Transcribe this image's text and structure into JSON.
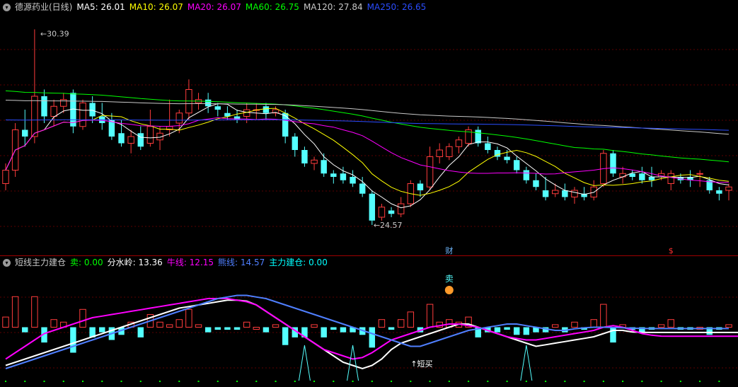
{
  "main_legend": {
    "title": "德源药业(日线)",
    "items": [
      {
        "label": "MA5: 26.01",
        "color": "#ffffff"
      },
      {
        "label": "MA10: 26.07",
        "color": "#ffff00"
      },
      {
        "label": "MA20: 26.07",
        "color": "#ff00ff"
      },
      {
        "label": "MA60: 26.75",
        "color": "#00ff00"
      },
      {
        "label": "MA120: 27.84",
        "color": "#c8c8c8"
      },
      {
        "label": "MA250: 26.65",
        "color": "#2a4dff"
      }
    ]
  },
  "sub_legend": {
    "title": "短线主力建仓",
    "items": [
      {
        "label": "卖: 0.00",
        "color": "#00ff00"
      },
      {
        "label": "分水岭: 13.36",
        "color": "#ffffff"
      },
      {
        "label": "牛线: 12.15",
        "color": "#ff00ff"
      },
      {
        "label": "熊线: 14.57",
        "color": "#4f7fff"
      },
      {
        "label": "主力建仓: 0.00",
        "color": "#00ffff"
      }
    ]
  },
  "chart_data": [
    {
      "type": "candlestick",
      "title": "德源药业(日线)",
      "annotations": {
        "high": "30.39",
        "low": "24.57",
        "fin_marker": "财",
        "dollar_marker": "$"
      },
      "ylim": [
        24.0,
        30.8
      ],
      "candles": [
        [
          25.8,
          26.4,
          25.6,
          26.2
        ],
        [
          26.2,
          27.6,
          26.0,
          27.4
        ],
        [
          27.4,
          28.0,
          26.9,
          27.2
        ],
        [
          27.2,
          30.39,
          27.0,
          28.4
        ],
        [
          28.4,
          28.6,
          27.6,
          27.8
        ],
        [
          27.8,
          28.3,
          27.5,
          28.1
        ],
        [
          28.1,
          28.5,
          27.9,
          28.3
        ],
        [
          28.5,
          28.6,
          27.3,
          27.5
        ],
        [
          27.5,
          28.3,
          27.4,
          28.2
        ],
        [
          28.2,
          28.4,
          27.6,
          27.8
        ],
        [
          27.8,
          28.2,
          27.4,
          27.6
        ],
        [
          27.7,
          27.9,
          27.1,
          27.2
        ],
        [
          27.3,
          27.7,
          26.9,
          27.0
        ],
        [
          27.0,
          27.4,
          26.7,
          27.2
        ],
        [
          27.3,
          27.5,
          26.8,
          26.9
        ],
        [
          27.0,
          28.0,
          26.9,
          27.5
        ],
        [
          27.1,
          27.5,
          26.8,
          27.3
        ],
        [
          27.4,
          28.3,
          27.2,
          27.5
        ],
        [
          27.6,
          28.0,
          27.3,
          27.9
        ],
        [
          27.9,
          28.9,
          27.7,
          28.6
        ],
        [
          28.2,
          28.5,
          28.0,
          28.3
        ],
        [
          28.3,
          28.5,
          27.9,
          28.1
        ],
        [
          28.1,
          28.2,
          27.8,
          28.0
        ],
        [
          27.9,
          28.1,
          27.7,
          27.8
        ],
        [
          27.8,
          28.0,
          27.6,
          27.7
        ],
        [
          27.8,
          28.2,
          27.6,
          28.0
        ],
        [
          28.0,
          28.2,
          27.7,
          28.0
        ],
        [
          28.1,
          28.2,
          27.7,
          27.9
        ],
        [
          27.9,
          28.1,
          27.8,
          28.0
        ],
        [
          27.9,
          28.0,
          27.0,
          27.2
        ],
        [
          27.2,
          27.3,
          26.6,
          26.8
        ],
        [
          26.8,
          26.9,
          26.3,
          26.4
        ],
        [
          26.4,
          26.6,
          26.2,
          26.5
        ],
        [
          26.5,
          26.7,
          26.0,
          26.1
        ],
        [
          26.1,
          26.2,
          25.8,
          26.0
        ],
        [
          26.1,
          26.3,
          25.8,
          25.9
        ],
        [
          26.0,
          26.2,
          25.7,
          25.8
        ],
        [
          25.8,
          26.0,
          25.4,
          25.5
        ],
        [
          25.5,
          25.6,
          24.57,
          24.7
        ],
        [
          24.8,
          25.2,
          24.7,
          25.1
        ],
        [
          25.0,
          25.1,
          24.8,
          24.9
        ],
        [
          24.9,
          25.4,
          24.8,
          25.2
        ],
        [
          25.2,
          25.9,
          25.1,
          25.8
        ],
        [
          25.8,
          25.9,
          25.4,
          25.6
        ],
        [
          25.7,
          26.9,
          25.6,
          26.6
        ],
        [
          26.6,
          27.0,
          26.4,
          26.8
        ],
        [
          26.6,
          27.0,
          26.5,
          26.9
        ],
        [
          26.9,
          27.2,
          26.7,
          27.1
        ],
        [
          27.0,
          27.5,
          26.9,
          27.4
        ],
        [
          27.4,
          27.5,
          26.9,
          27.0
        ],
        [
          27.0,
          27.2,
          26.7,
          26.8
        ],
        [
          26.8,
          26.9,
          26.5,
          26.6
        ],
        [
          26.6,
          26.8,
          26.4,
          26.5
        ],
        [
          26.5,
          26.6,
          26.1,
          26.2
        ],
        [
          26.2,
          26.3,
          25.8,
          25.9
        ],
        [
          25.9,
          26.1,
          25.6,
          25.7
        ],
        [
          25.6,
          26.0,
          25.3,
          25.4
        ],
        [
          25.5,
          25.8,
          25.4,
          25.6
        ],
        [
          25.6,
          25.8,
          25.3,
          25.4
        ],
        [
          25.4,
          25.7,
          25.2,
          25.6
        ],
        [
          25.5,
          25.7,
          25.3,
          25.4
        ],
        [
          25.4,
          25.9,
          25.3,
          25.7
        ],
        [
          25.8,
          26.8,
          25.7,
          26.7
        ],
        [
          26.7,
          26.8,
          26.0,
          26.1
        ],
        [
          26.0,
          26.3,
          25.8,
          26.1
        ],
        [
          26.1,
          26.2,
          25.9,
          26.0
        ],
        [
          26.1,
          26.3,
          25.8,
          25.9
        ],
        [
          26.0,
          26.3,
          25.7,
          25.9
        ],
        [
          26.0,
          26.2,
          25.9,
          26.1
        ],
        [
          25.8,
          26.2,
          25.6,
          26.1
        ],
        [
          26.0,
          26.1,
          25.8,
          25.9
        ],
        [
          26.0,
          26.2,
          25.7,
          25.9
        ],
        [
          26.1,
          26.2,
          25.7,
          26.1
        ],
        [
          25.9,
          26.0,
          25.5,
          25.6
        ],
        [
          25.6,
          25.7,
          25.3,
          25.5
        ],
        [
          25.6,
          25.8,
          25.3,
          25.7
        ]
      ]
    },
    {
      "type": "indicator",
      "title": "短线主力建仓",
      "ylim": [
        0,
        30
      ],
      "series": [
        {
          "name": "分水岭",
          "color": "#ffffff",
          "values": [
            3,
            4,
            5,
            6,
            7,
            8,
            9,
            10,
            11,
            12,
            13,
            14,
            15,
            16,
            17,
            18,
            19,
            20,
            21,
            21.5,
            22,
            22.5,
            23,
            23.5,
            23.5,
            23.2,
            22,
            20,
            18,
            16,
            14,
            12,
            10,
            8,
            6,
            4,
            3,
            2,
            3,
            5,
            8,
            10,
            11,
            12,
            13,
            14,
            15,
            16,
            16,
            15,
            14,
            13,
            12,
            11,
            10,
            9,
            9.5,
            10,
            10.5,
            11,
            11.5,
            12,
            13,
            14,
            14,
            13.5,
            13.4,
            13.36,
            13.36,
            13.36,
            13.36,
            13.36,
            13.36,
            13.36,
            13.36,
            13.36,
            13.36
          ]
        },
        {
          "name": "牛线",
          "color": "#ff00ff",
          "values": [
            5,
            7,
            9,
            11,
            13,
            14,
            15,
            16,
            17,
            18,
            18.5,
            19,
            19.5,
            20,
            20.5,
            21,
            21.5,
            22,
            22.5,
            23,
            23.5,
            24,
            24,
            24,
            23.5,
            23,
            22,
            20,
            18,
            16,
            14,
            12,
            10,
            8,
            7,
            6,
            5,
            5.5,
            7,
            9,
            11,
            12,
            13,
            14,
            15,
            15.5,
            16,
            16,
            15.5,
            15,
            14,
            13,
            12,
            11.5,
            11,
            11,
            11.5,
            12,
            12.5,
            13,
            13.5,
            14,
            15,
            15.5,
            15,
            14,
            13,
            12.5,
            12.2,
            12.15,
            12.15,
            12.15,
            12.15,
            12.15,
            12.15,
            12.15,
            12.15
          ]
        },
        {
          "name": "熊线",
          "color": "#4f7fff",
          "values": [
            2,
            3,
            4,
            5,
            6,
            7,
            8,
            9,
            10,
            11,
            12,
            13,
            14,
            15,
            16,
            17,
            18,
            19,
            20,
            21,
            22,
            23,
            24,
            24.5,
            25,
            25,
            24.5,
            24,
            23,
            22,
            21,
            20,
            19,
            18,
            17,
            16,
            15,
            14,
            13,
            12,
            11,
            10,
            9,
            9,
            10,
            11,
            12,
            13,
            14,
            14.5,
            15,
            15.5,
            16,
            16,
            15.5,
            15,
            14.5,
            14,
            14,
            14.5,
            14.8,
            15,
            15,
            14.9,
            14.8,
            14.7,
            14.6,
            14.57,
            14.57,
            14.57,
            14.57,
            14.57,
            14.57,
            14.57,
            14.57,
            14.57
          ]
        }
      ],
      "text_labels": [
        "卖",
        "↑短买"
      ]
    }
  ]
}
